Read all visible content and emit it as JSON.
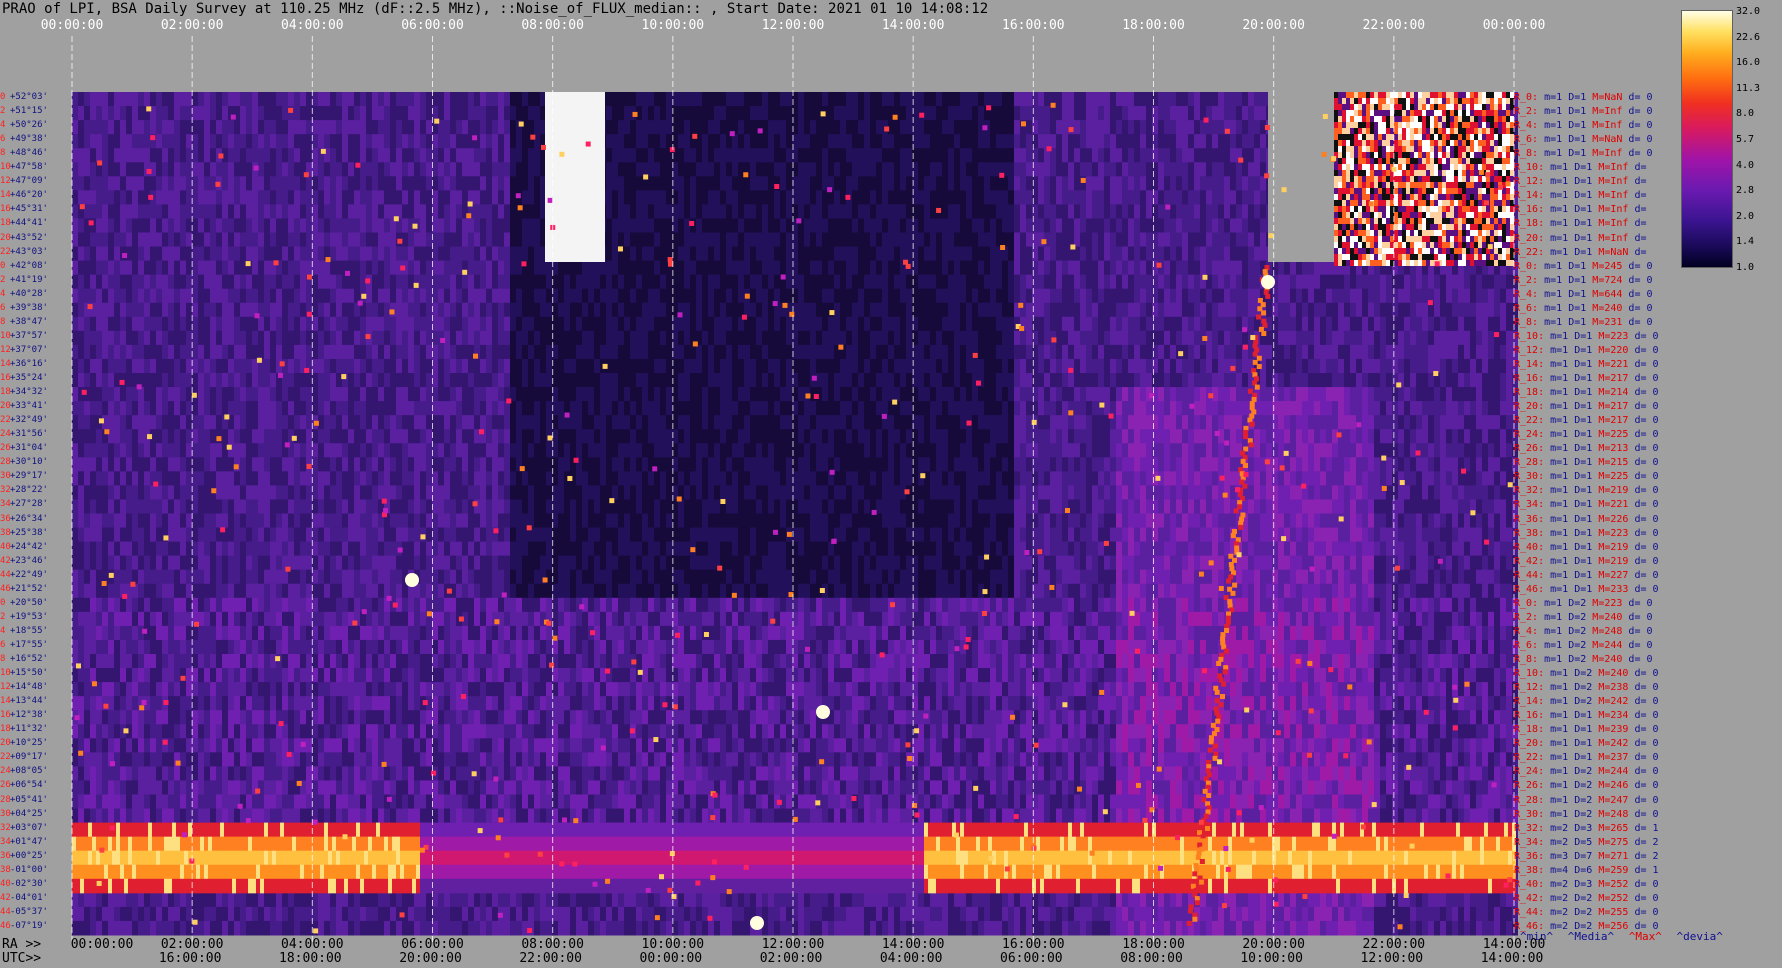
{
  "title": "PRAO of LPI, BSA Daily Survey at 110.25 MHz (dF::2.5 MHz), ::Noise_of_FLUX_median:: , Start Date: 2021 01 10 14:08:12",
  "chart_data": {
    "type": "heatmap",
    "title": "PRAO of LPI, BSA Daily Survey at 110.25 MHz (dF::2.5 MHz), ::Noise_of_FLUX_median:: , Start Date: 2021 01 10 14:08:12",
    "x_top_ticks": [
      "00:00:00",
      "02:00:00",
      "04:00:00",
      "06:00:00",
      "08:00:00",
      "10:00:00",
      "12:00:00",
      "14:00:00",
      "16:00:00",
      "18:00:00",
      "20:00:00",
      "22:00:00",
      "00:00:00"
    ],
    "ra_prefix": "RA >>",
    "utc_prefix": "UTC>>",
    "ra_ticks": [
      "00:00:00",
      "02:00:00",
      "04:00:00",
      "06:00:00",
      "08:00:00",
      "10:00:00",
      "12:00:00",
      "14:00:00",
      "16:00:00",
      "18:00:00",
      "20:00:00",
      "22:00:00",
      "14:00:00"
    ],
    "utc_ticks": [
      "16:00:00",
      "18:00:00",
      "20:00:00",
      "22:00:00",
      "00:00:00",
      "02:00:00",
      "04:00:00",
      "06:00:00",
      "08:00:00",
      "10:00:00",
      "12:00:00",
      "14:00:00"
    ],
    "colorbar": {
      "ticks": [
        "32.0",
        "22.6",
        "16.0",
        "11.3",
        "8.0",
        "5.7",
        "4.0",
        "2.8",
        "2.0",
        "1.4",
        "1.0"
      ],
      "scale": "log2",
      "range": [
        1.0,
        32.0
      ]
    },
    "declination_rows": [
      {
        "idx": "0",
        "dec": "+52°03'"
      },
      {
        "idx": "2",
        "dec": "+51°15'"
      },
      {
        "idx": "4",
        "dec": "+50°26'"
      },
      {
        "idx": "6",
        "dec": "+49°38'"
      },
      {
        "idx": "8",
        "dec": "+48°46'"
      },
      {
        "idx": "10",
        "dec": "+47°58'"
      },
      {
        "idx": "12",
        "dec": "+47°09'"
      },
      {
        "idx": "14",
        "dec": "+46°20'"
      },
      {
        "idx": "16",
        "dec": "+45°31'"
      },
      {
        "idx": "18",
        "dec": "+44°41'"
      },
      {
        "idx": "20",
        "dec": "+43°52'"
      },
      {
        "idx": "22",
        "dec": "+43°03'"
      },
      {
        "idx": "0",
        "dec": "+42°08'"
      },
      {
        "idx": "2",
        "dec": "+41°19'"
      },
      {
        "idx": "4",
        "dec": "+40°28'"
      },
      {
        "idx": "6",
        "dec": "+39°38'"
      },
      {
        "idx": "8",
        "dec": "+38°47'"
      },
      {
        "idx": "10",
        "dec": "+37°57'"
      },
      {
        "idx": "12",
        "dec": "+37°07'"
      },
      {
        "idx": "14",
        "dec": "+36°16'"
      },
      {
        "idx": "16",
        "dec": "+35°24'"
      },
      {
        "idx": "18",
        "dec": "+34°32'"
      },
      {
        "idx": "20",
        "dec": "+33°41'"
      },
      {
        "idx": "22",
        "dec": "+32°49'"
      },
      {
        "idx": "24",
        "dec": "+31°56'"
      },
      {
        "idx": "26",
        "dec": "+31°04'"
      },
      {
        "idx": "28",
        "dec": "+30°10'"
      },
      {
        "idx": "30",
        "dec": "+29°17'"
      },
      {
        "idx": "32",
        "dec": "+28°22'"
      },
      {
        "idx": "34",
        "dec": "+27°28'"
      },
      {
        "idx": "36",
        "dec": "+26°34'"
      },
      {
        "idx": "38",
        "dec": "+25°38'"
      },
      {
        "idx": "40",
        "dec": "+24°42'"
      },
      {
        "idx": "42",
        "dec": "+23°46'"
      },
      {
        "idx": "44",
        "dec": "+22°49'"
      },
      {
        "idx": "46",
        "dec": "+21°52'"
      },
      {
        "idx": "0",
        "dec": "+20°50'"
      },
      {
        "idx": "2",
        "dec": "+19°53'"
      },
      {
        "idx": "4",
        "dec": "+18°55'"
      },
      {
        "idx": "6",
        "dec": "+17°55'"
      },
      {
        "idx": "8",
        "dec": "+16°52'"
      },
      {
        "idx": "10",
        "dec": "+15°50'"
      },
      {
        "idx": "12",
        "dec": "+14°48'"
      },
      {
        "idx": "14",
        "dec": "+13°44'"
      },
      {
        "idx": "16",
        "dec": "+12°38'"
      },
      {
        "idx": "18",
        "dec": "+11°32'"
      },
      {
        "idx": "20",
        "dec": "+10°25'"
      },
      {
        "idx": "22",
        "dec": "+09°17'"
      },
      {
        "idx": "24",
        "dec": "+08°05'"
      },
      {
        "idx": "26",
        "dec": "+06°54'"
      },
      {
        "idx": "28",
        "dec": "+05°41'"
      },
      {
        "idx": "30",
        "dec": "+04°25'"
      },
      {
        "idx": "32",
        "dec": "+03°07'"
      },
      {
        "idx": "34",
        "dec": "+01°47'"
      },
      {
        "idx": "36",
        "dec": "+00°25'"
      },
      {
        "idx": "38",
        "dec": "-01°00'"
      },
      {
        "idx": "40",
        "dec": "-02°30'"
      },
      {
        "idx": "42",
        "dec": "-04°01'"
      },
      {
        "idx": "44",
        "dec": "-05°37'"
      },
      {
        "idx": "46",
        "dec": "-07°19'"
      }
    ],
    "stats": [
      {
        "r": "R_0:",
        "m": "m=1",
        "d": "D=1",
        "med": "M=NaN",
        "dev": "d= 0"
      },
      {
        "r": "R_2:",
        "m": "m=1",
        "d": "D=1",
        "med": "M=Inf",
        "dev": "d= 0"
      },
      {
        "r": "R_4:",
        "m": "m=1",
        "d": "D=1",
        "med": "M=Inf",
        "dev": "d= 0"
      },
      {
        "r": "R_6:",
        "m": "m=1",
        "d": "D=1",
        "med": "M=NaN",
        "dev": "d= 0"
      },
      {
        "r": "R_8:",
        "m": "m=1",
        "d": "D=1",
        "med": "M=Inf",
        "dev": "d= 0"
      },
      {
        "r": "R_10:",
        "m": "m=1",
        "d": "D=1",
        "med": "M=Inf",
        "dev": "d="
      },
      {
        "r": "R_12:",
        "m": "m=1",
        "d": "D=1",
        "med": "M=Inf",
        "dev": "d="
      },
      {
        "r": "R_14:",
        "m": "m=1",
        "d": "D=1",
        "med": "M=Inf",
        "dev": "d="
      },
      {
        "r": "R_16:",
        "m": "m=1",
        "d": "D=1",
        "med": "M=Inf",
        "dev": "d="
      },
      {
        "r": "R_18:",
        "m": "m=1",
        "d": "D=1",
        "med": "M=Inf",
        "dev": "d="
      },
      {
        "r": "R_20:",
        "m": "m=1",
        "d": "D=1",
        "med": "M=Inf",
        "dev": "d="
      },
      {
        "r": "R_22:",
        "m": "m=1",
        "d": "D=1",
        "med": "M=NaN",
        "dev": "d="
      },
      {
        "r": "R_0:",
        "m": "m=1",
        "d": "D=1",
        "med": "M=245",
        "dev": "d= 0"
      },
      {
        "r": "R_2:",
        "m": "m=1",
        "d": "D=1",
        "med": "M=724",
        "dev": "d= 0"
      },
      {
        "r": "R_4:",
        "m": "m=1",
        "d": "D=1",
        "med": "M=644",
        "dev": "d= 0"
      },
      {
        "r": "R_6:",
        "m": "m=1",
        "d": "D=1",
        "med": "M=240",
        "dev": "d= 0"
      },
      {
        "r": "R_8:",
        "m": "m=1",
        "d": "D=1",
        "med": "M=231",
        "dev": "d= 0"
      },
      {
        "r": "R_10:",
        "m": "m=1",
        "d": "D=1",
        "med": "M=223",
        "dev": "d= 0"
      },
      {
        "r": "R_12:",
        "m": "m=1",
        "d": "D=1",
        "med": "M=220",
        "dev": "d= 0"
      },
      {
        "r": "R_14:",
        "m": "m=1",
        "d": "D=1",
        "med": "M=221",
        "dev": "d= 0"
      },
      {
        "r": "R_16:",
        "m": "m=1",
        "d": "D=1",
        "med": "M=217",
        "dev": "d= 0"
      },
      {
        "r": "R_18:",
        "m": "m=1",
        "d": "D=1",
        "med": "M=214",
        "dev": "d= 0"
      },
      {
        "r": "R_20:",
        "m": "m=1",
        "d": "D=1",
        "med": "M=217",
        "dev": "d= 0"
      },
      {
        "r": "R_22:",
        "m": "m=1",
        "d": "D=1",
        "med": "M=217",
        "dev": "d= 0"
      },
      {
        "r": "R_24:",
        "m": "m=1",
        "d": "D=1",
        "med": "M=225",
        "dev": "d= 0"
      },
      {
        "r": "R_26:",
        "m": "m=1",
        "d": "D=1",
        "med": "M=213",
        "dev": "d= 0"
      },
      {
        "r": "R_28:",
        "m": "m=1",
        "d": "D=1",
        "med": "M=215",
        "dev": "d= 0"
      },
      {
        "r": "R_30:",
        "m": "m=1",
        "d": "D=1",
        "med": "M=225",
        "dev": "d= 0"
      },
      {
        "r": "R_32:",
        "m": "m=1",
        "d": "D=1",
        "med": "M=219",
        "dev": "d= 0"
      },
      {
        "r": "R_34:",
        "m": "m=1",
        "d": "D=1",
        "med": "M=221",
        "dev": "d= 0"
      },
      {
        "r": "R_36:",
        "m": "m=1",
        "d": "D=1",
        "med": "M=226",
        "dev": "d= 0"
      },
      {
        "r": "R_38:",
        "m": "m=1",
        "d": "D=1",
        "med": "M=223",
        "dev": "d= 0"
      },
      {
        "r": "R_40:",
        "m": "m=1",
        "d": "D=1",
        "med": "M=219",
        "dev": "d= 0"
      },
      {
        "r": "R_42:",
        "m": "m=1",
        "d": "D=1",
        "med": "M=219",
        "dev": "d= 0"
      },
      {
        "r": "R_44:",
        "m": "m=1",
        "d": "D=1",
        "med": "M=227",
        "dev": "d= 0"
      },
      {
        "r": "R_46:",
        "m": "m=1",
        "d": "D=1",
        "med": "M=233",
        "dev": "d= 0"
      },
      {
        "r": "R_0:",
        "m": "m=1",
        "d": "D=2",
        "med": "M=223",
        "dev": "d= 0"
      },
      {
        "r": "R_2:",
        "m": "m=1",
        "d": "D=2",
        "med": "M=240",
        "dev": "d= 0"
      },
      {
        "r": "R_4:",
        "m": "m=1",
        "d": "D=2",
        "med": "M=248",
        "dev": "d= 0"
      },
      {
        "r": "R_6:",
        "m": "m=1",
        "d": "D=2",
        "med": "M=244",
        "dev": "d= 0"
      },
      {
        "r": "R_8:",
        "m": "m=1",
        "d": "D=2",
        "med": "M=240",
        "dev": "d= 0"
      },
      {
        "r": "R_10:",
        "m": "m=1",
        "d": "D=2",
        "med": "M=240",
        "dev": "d= 0"
      },
      {
        "r": "R_12:",
        "m": "m=1",
        "d": "D=2",
        "med": "M=238",
        "dev": "d= 0"
      },
      {
        "r": "R_14:",
        "m": "m=1",
        "d": "D=2",
        "med": "M=242",
        "dev": "d= 0"
      },
      {
        "r": "R_16:",
        "m": "m=1",
        "d": "D=1",
        "med": "M=234",
        "dev": "d= 0"
      },
      {
        "r": "R_18:",
        "m": "m=1",
        "d": "D=1",
        "med": "M=239",
        "dev": "d= 0"
      },
      {
        "r": "R_20:",
        "m": "m=1",
        "d": "D=1",
        "med": "M=242",
        "dev": "d= 0"
      },
      {
        "r": "R_22:",
        "m": "m=1",
        "d": "D=1",
        "med": "M=237",
        "dev": "d= 0"
      },
      {
        "r": "R_24:",
        "m": "m=1",
        "d": "D=2",
        "med": "M=244",
        "dev": "d= 0"
      },
      {
        "r": "R_26:",
        "m": "m=1",
        "d": "D=2",
        "med": "M=246",
        "dev": "d= 0"
      },
      {
        "r": "R_28:",
        "m": "m=1",
        "d": "D=2",
        "med": "M=247",
        "dev": "d= 0"
      },
      {
        "r": "R_30:",
        "m": "m=1",
        "d": "D=2",
        "med": "M=248",
        "dev": "d= 0"
      },
      {
        "r": "R_32:",
        "m": "m=2",
        "d": "D=3",
        "med": "M=265",
        "dev": "d= 1"
      },
      {
        "r": "R_34:",
        "m": "m=2",
        "d": "D=5",
        "med": "M=275",
        "dev": "d= 2"
      },
      {
        "r": "R_36:",
        "m": "m=3",
        "d": "D=7",
        "med": "M=271",
        "dev": "d= 2"
      },
      {
        "r": "R_38:",
        "m": "m=4",
        "d": "D=6",
        "med": "M=259",
        "dev": "d= 1"
      },
      {
        "r": "R_40:",
        "m": "m=2",
        "d": "D=3",
        "med": "M=252",
        "dev": "d= 0"
      },
      {
        "r": "R_42:",
        "m": "m=2",
        "d": "D=2",
        "med": "M=252",
        "dev": "d= 0"
      },
      {
        "r": "R_44:",
        "m": "m=2",
        "d": "D=2",
        "med": "M=255",
        "dev": "d= 0"
      },
      {
        "r": "R_46:",
        "m": "m=2",
        "d": "D=2",
        "med": "M=256",
        "dev": "d= 0"
      }
    ],
    "legend": [
      "^min^",
      "^Media^",
      "^Max^",
      "^devia^"
    ]
  }
}
